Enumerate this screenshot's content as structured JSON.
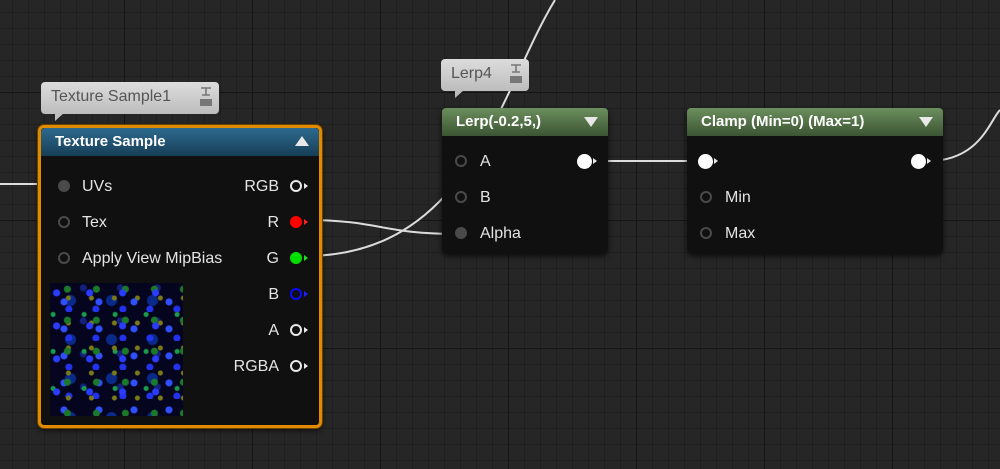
{
  "nodes": {
    "texture_sample": {
      "comment": "Texture Sample1",
      "title": "Texture Sample",
      "inputs": [
        "UVs",
        "Tex",
        "Apply View MipBias"
      ],
      "outputs": [
        "RGB",
        "R",
        "G",
        "B",
        "A",
        "RGBA"
      ],
      "selected": true
    },
    "lerp": {
      "comment": "Lerp4",
      "title": "Lerp(-0.2,5,)",
      "inputs": [
        "A",
        "B",
        "Alpha"
      ]
    },
    "clamp": {
      "title": "Clamp (Min=0) (Max=1)",
      "inputs": [
        "Min",
        "Max"
      ]
    }
  },
  "colors": {
    "r_pin": "#ff0000",
    "g_pin": "#00e000",
    "b_pin": "#0a0aff",
    "selection": "#e08a00"
  }
}
